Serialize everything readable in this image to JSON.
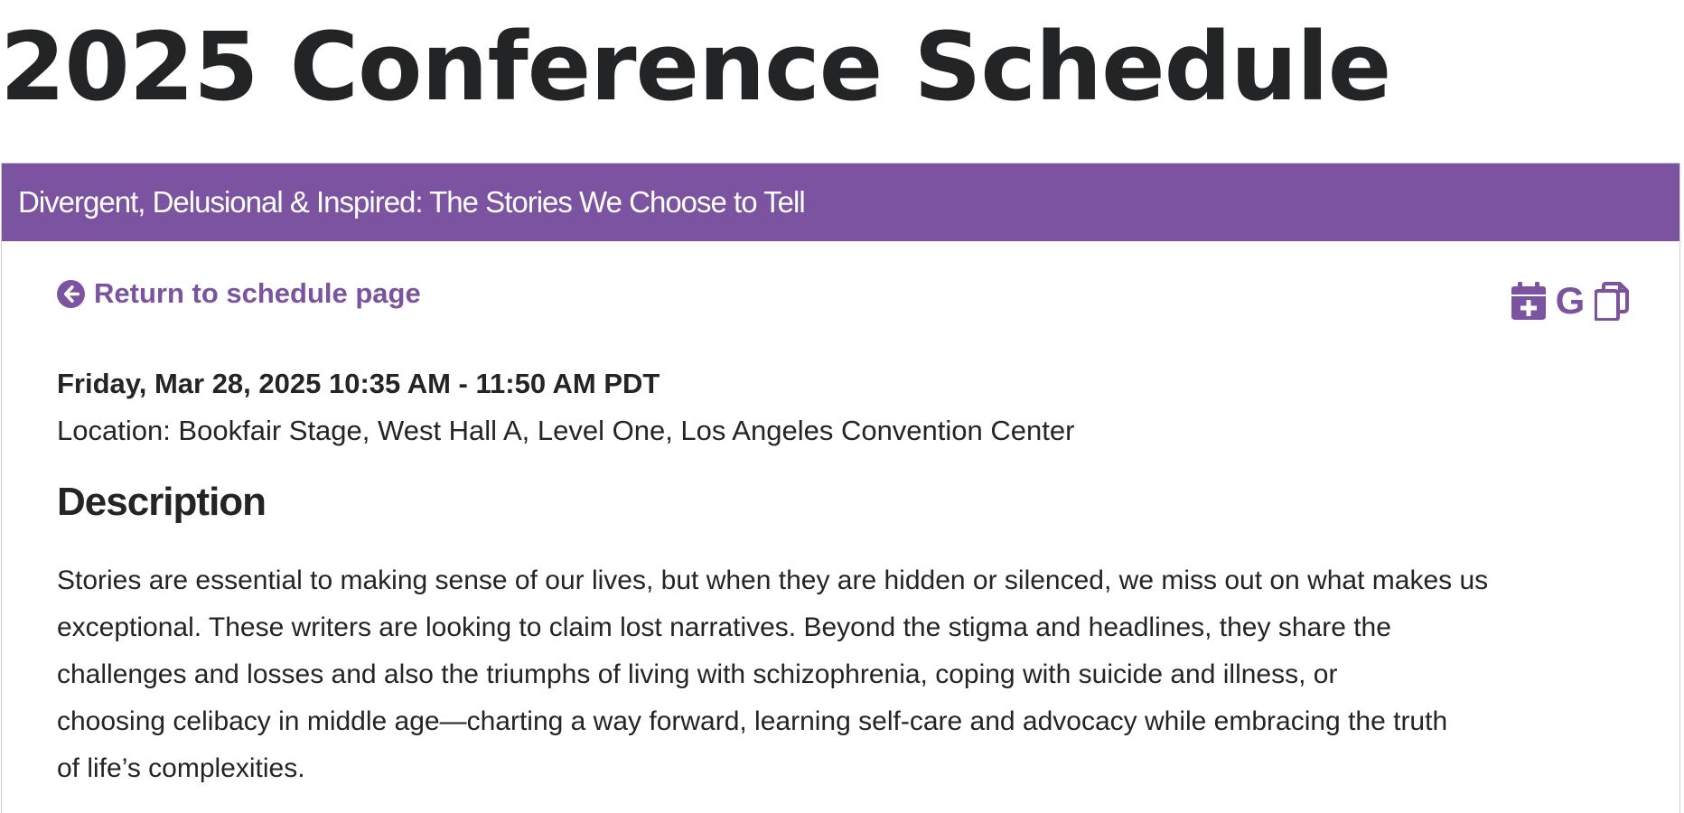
{
  "page": {
    "title": "2025 Conference Schedule"
  },
  "session": {
    "title": "Divergent, Delusional & Inspired: The Stories We Choose to Tell",
    "return_link": "Return to schedule page",
    "datetime": "Friday, Mar 28, 2025 10:35 AM - 11:50 AM PDT",
    "location": "Location: Bookfair Stage, West Hall A, Level One, Los Angeles Convention Center",
    "description_heading": "Description",
    "description_lines": [
      "Stories are essential to making sense of our lives, but when they are hidden or silenced, we miss out on what makes us",
      "exceptional. These writers are looking to claim lost narratives. Beyond the stigma and headlines, they share the",
      "challenges and losses and also the triumphs of living with schizophrenia, coping with suicide and illness, or",
      "choosing celibacy in middle age—charting a way forward, learning self-care and advocacy while embracing the truth",
      "of life’s complexities."
    ]
  },
  "actions": {
    "add_to_calendar_icon": "calendar-plus-icon",
    "google_calendar_icon": "google-icon",
    "copy_icon": "copy-icon"
  },
  "colors": {
    "accent": "#7b53a1",
    "text": "#222426",
    "header_text": "#ffffff"
  }
}
